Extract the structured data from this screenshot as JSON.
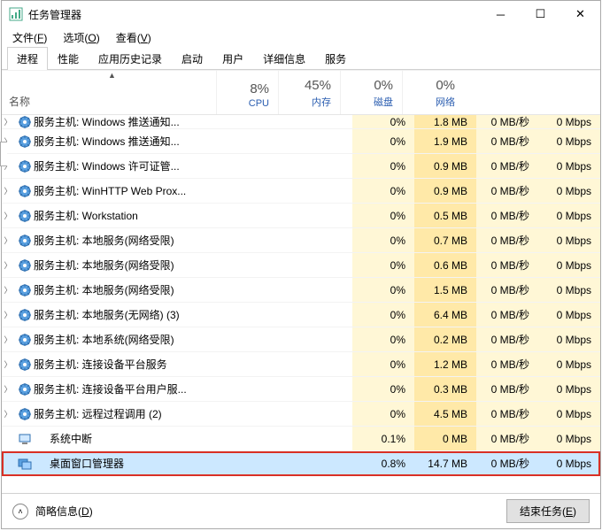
{
  "window": {
    "title": "任务管理器"
  },
  "menus": [
    {
      "label": "文件",
      "key": "F"
    },
    {
      "label": "选项",
      "key": "O"
    },
    {
      "label": "查看",
      "key": "V"
    }
  ],
  "tabs": [
    "进程",
    "性能",
    "应用历史记录",
    "启动",
    "用户",
    "详细信息",
    "服务"
  ],
  "active_tab": 0,
  "columns": {
    "name": "名称",
    "stats": [
      {
        "pct": "8%",
        "label": "CPU"
      },
      {
        "pct": "45%",
        "label": "内存"
      },
      {
        "pct": "0%",
        "label": "磁盘"
      },
      {
        "pct": "0%",
        "label": "网络"
      }
    ]
  },
  "rows": [
    {
      "exp": true,
      "icon": "svc",
      "name": "服务主机: Windows 推送通知...",
      "cpu": "0%",
      "mem": "1.8 MB",
      "disk": "0 MB/秒",
      "net": "0 Mbps",
      "partial": true
    },
    {
      "exp": true,
      "icon": "svc",
      "name": "服务主机: Windows 推送通知...",
      "cpu": "0%",
      "mem": "1.9 MB",
      "disk": "0 MB/秒",
      "net": "0 Mbps"
    },
    {
      "exp": true,
      "icon": "svc",
      "name": "服务主机: Windows 许可证管...",
      "cpu": "0%",
      "mem": "0.9 MB",
      "disk": "0 MB/秒",
      "net": "0 Mbps"
    },
    {
      "exp": true,
      "icon": "svc",
      "name": "服务主机: WinHTTP Web Prox...",
      "cpu": "0%",
      "mem": "0.9 MB",
      "disk": "0 MB/秒",
      "net": "0 Mbps"
    },
    {
      "exp": true,
      "icon": "svc",
      "name": "服务主机: Workstation",
      "cpu": "0%",
      "mem": "0.5 MB",
      "disk": "0 MB/秒",
      "net": "0 Mbps"
    },
    {
      "exp": true,
      "icon": "svc",
      "name": "服务主机: 本地服务(网络受限)",
      "cpu": "0%",
      "mem": "0.7 MB",
      "disk": "0 MB/秒",
      "net": "0 Mbps"
    },
    {
      "exp": true,
      "icon": "svc",
      "name": "服务主机: 本地服务(网络受限)",
      "cpu": "0%",
      "mem": "0.6 MB",
      "disk": "0 MB/秒",
      "net": "0 Mbps"
    },
    {
      "exp": true,
      "icon": "svc",
      "name": "服务主机: 本地服务(网络受限)",
      "cpu": "0%",
      "mem": "1.5 MB",
      "disk": "0 MB/秒",
      "net": "0 Mbps"
    },
    {
      "exp": true,
      "icon": "svc",
      "name": "服务主机: 本地服务(无网络) (3)",
      "cpu": "0%",
      "mem": "6.4 MB",
      "disk": "0 MB/秒",
      "net": "0 Mbps"
    },
    {
      "exp": true,
      "icon": "svc",
      "name": "服务主机: 本地系统(网络受限)",
      "cpu": "0%",
      "mem": "0.2 MB",
      "disk": "0 MB/秒",
      "net": "0 Mbps"
    },
    {
      "exp": true,
      "icon": "svc",
      "name": "服务主机: 连接设备平台服务",
      "cpu": "0%",
      "mem": "1.2 MB",
      "disk": "0 MB/秒",
      "net": "0 Mbps"
    },
    {
      "exp": true,
      "icon": "svc",
      "name": "服务主机: 连接设备平台用户服...",
      "cpu": "0%",
      "mem": "0.3 MB",
      "disk": "0 MB/秒",
      "net": "0 Mbps"
    },
    {
      "exp": true,
      "icon": "svc",
      "name": "服务主机: 远程过程调用 (2)",
      "cpu": "0%",
      "mem": "4.5 MB",
      "disk": "0 MB/秒",
      "net": "0 Mbps"
    },
    {
      "exp": false,
      "icon": "sys",
      "name": "系统中断",
      "cpu": "0.1%",
      "mem": "0 MB",
      "disk": "0 MB/秒",
      "net": "0 Mbps",
      "indent": true
    },
    {
      "exp": false,
      "icon": "dwm",
      "name": "桌面窗口管理器",
      "cpu": "0.8%",
      "mem": "14.7 MB",
      "disk": "0 MB/秒",
      "net": "0 Mbps",
      "indent": true,
      "highlighted": true
    }
  ],
  "footer": {
    "fewer": "简略信息",
    "fewer_key": "D",
    "end": "结束任务",
    "end_key": "E"
  }
}
